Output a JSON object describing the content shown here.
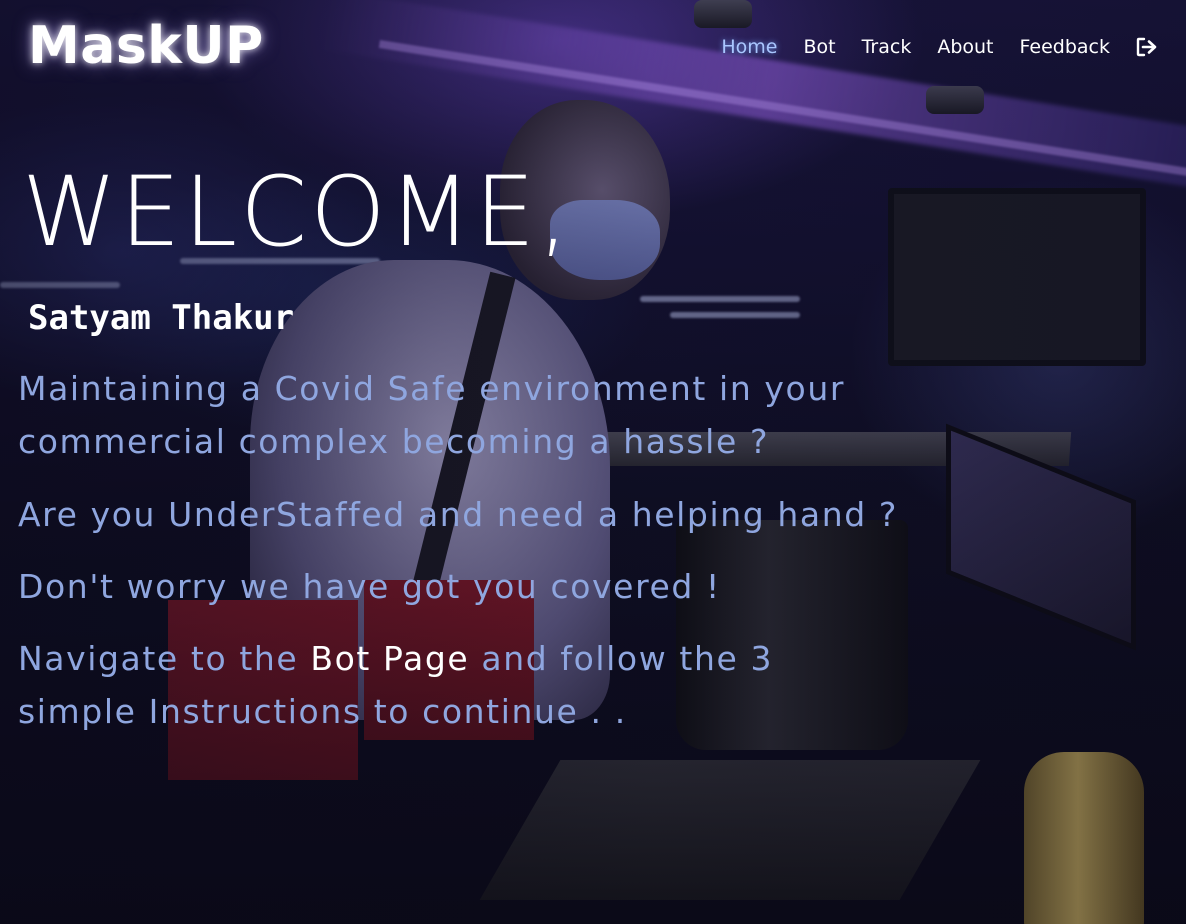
{
  "header": {
    "logo": "MaskUP",
    "nav": [
      {
        "label": "Home",
        "active": true
      },
      {
        "label": "Bot",
        "active": false
      },
      {
        "label": "Track",
        "active": false
      },
      {
        "label": "About",
        "active": false
      },
      {
        "label": "Feedback",
        "active": false
      }
    ],
    "logout_icon": "sign-out-icon"
  },
  "hero": {
    "welcome": "WELCOME,",
    "username": "Satyam Thakur",
    "messages": {
      "line1": "Maintaining a Covid Safe environment in your commercial complex becoming a hassle ?",
      "line2": "Are you UnderStaffed and need a helping hand ?",
      "line3": "Don't worry we have got you covered !",
      "line4_before": "Navigate to the ",
      "line4_link": "Bot Page",
      "line4_after": " and follow the 3 simple Instructions to continue . ."
    }
  },
  "colors": {
    "nav_active": "#a9c6ff",
    "message_text": "#8fa6df",
    "link_text": "#ffffff"
  }
}
